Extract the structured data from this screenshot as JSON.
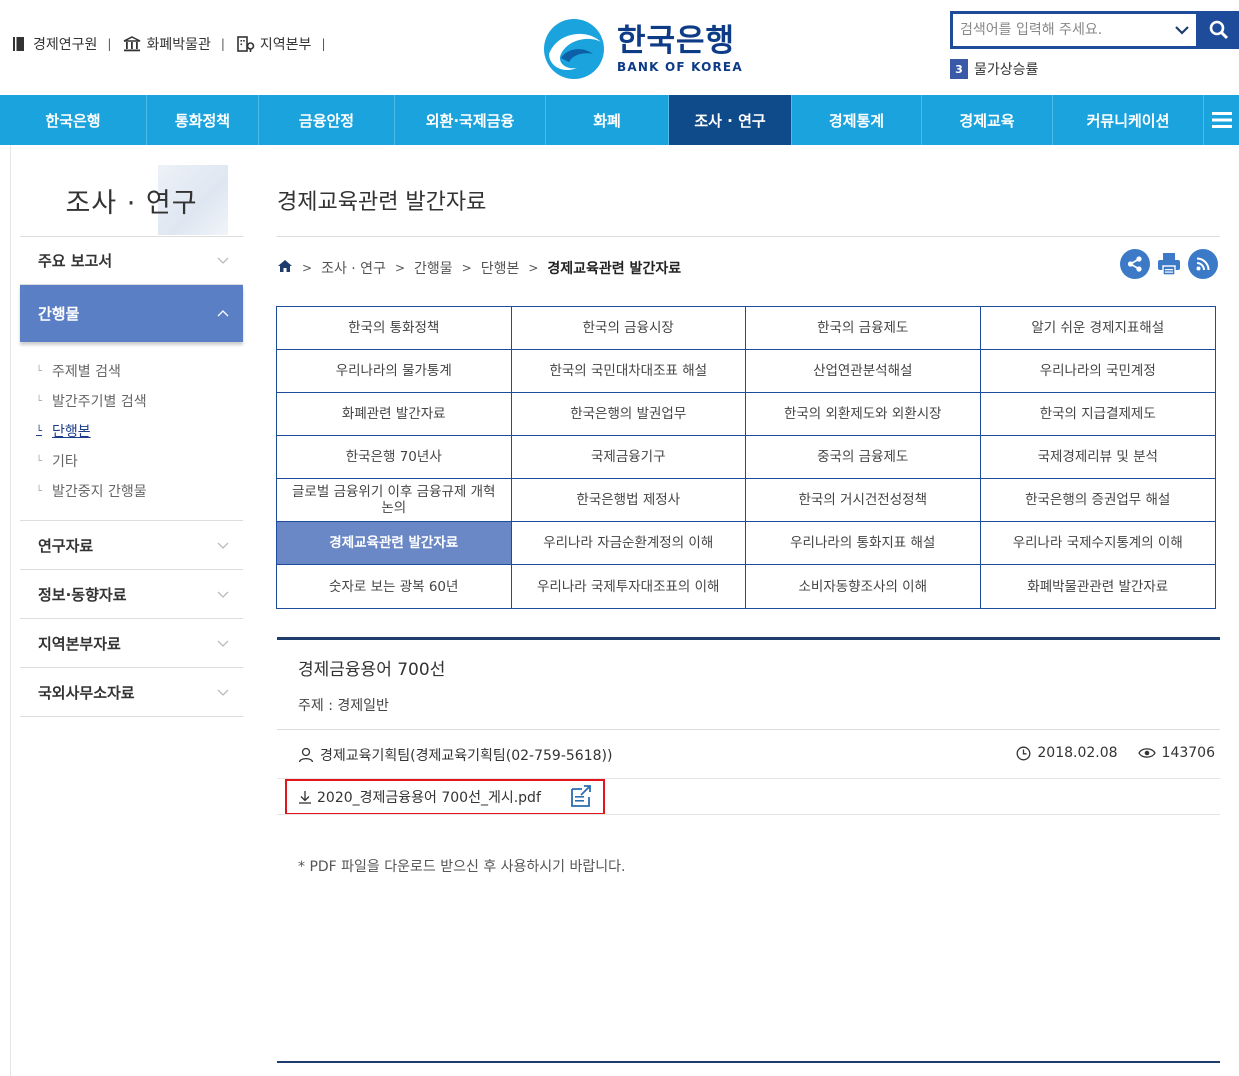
{
  "util": {
    "links": [
      "경제연구원",
      "화폐박물관",
      "지역본부"
    ]
  },
  "logo": {
    "ko": "한국은행",
    "en": "BANK OF KOREA"
  },
  "search": {
    "placeholder": "검색어를 입력해 주세요.",
    "trend_rank": "3",
    "trend_text": "물가상승률"
  },
  "gnb": {
    "items": [
      "한국은행",
      "통화정책",
      "금융안정",
      "외환·국제금융",
      "화폐",
      "조사 · 연구",
      "경제통계",
      "경제교육",
      "커뮤니케이션"
    ],
    "active_index": 5
  },
  "side": {
    "title": "조사 · 연구",
    "menu": {
      "main_reports": "주요 보고서",
      "publications": "간행물",
      "sub": [
        "주제별 검색",
        "발간주기별 검색",
        "단행본",
        "기타",
        "발간중지 간행물"
      ],
      "research": "연구자료",
      "info": "정보·동향자료",
      "regional": "지역본부자료",
      "overseas": "국외사무소자료"
    }
  },
  "content": {
    "page_title": "경제교육관련 발간자료",
    "breadcrumb": [
      "조사 · 연구",
      "간행물",
      "단행본",
      "경제교육관련 발간자료"
    ],
    "grid": [
      "한국의 통화정책",
      "한국의 금융시장",
      "한국의 금융제도",
      "알기 쉬운 경제지표해설",
      "우리나라의 물가통계",
      "한국의 국민대차대조표 해설",
      "산업연관분석해설",
      "우리나라의 국민계정",
      "화폐관련 발간자료",
      "한국은행의 발권업무",
      "한국의 외환제도와 외환시장",
      "한국의 지급결제제도",
      "한국은행 70년사",
      "국제금융기구",
      "중국의 금융제도",
      "국제경제리뷰 및 분석",
      "글로벌 금융위기 이후 금융규제 개혁 논의",
      "한국은행법 제정사",
      "한국의 거시건전성정책",
      "한국은행의 증권업무 해설",
      "경제교육관련 발간자료",
      "우리나라 자금순환계정의 이해",
      "우리나라의 통화지표 해설",
      "우리나라 국제수지통계의 이해",
      "숫자로 보는 광복 60년",
      "우리나라 국제투자대조표의 이해",
      "소비자동향조사의 이해",
      "화폐박물관관련 발간자료"
    ],
    "active_grid_index": 20,
    "view": {
      "title": "경제금융용어 700선",
      "subject": "주제 : 경제일반",
      "author": "경제교육기획팀(경제교육기획팀(02-759-5618))",
      "date": "2018.02.08",
      "views": "143706",
      "file": "2020_경제금융용어 700선_게시.pdf",
      "note": "* PDF 파일을 다운로드 받으신 후 사용하시기 바랍니다."
    }
  }
}
